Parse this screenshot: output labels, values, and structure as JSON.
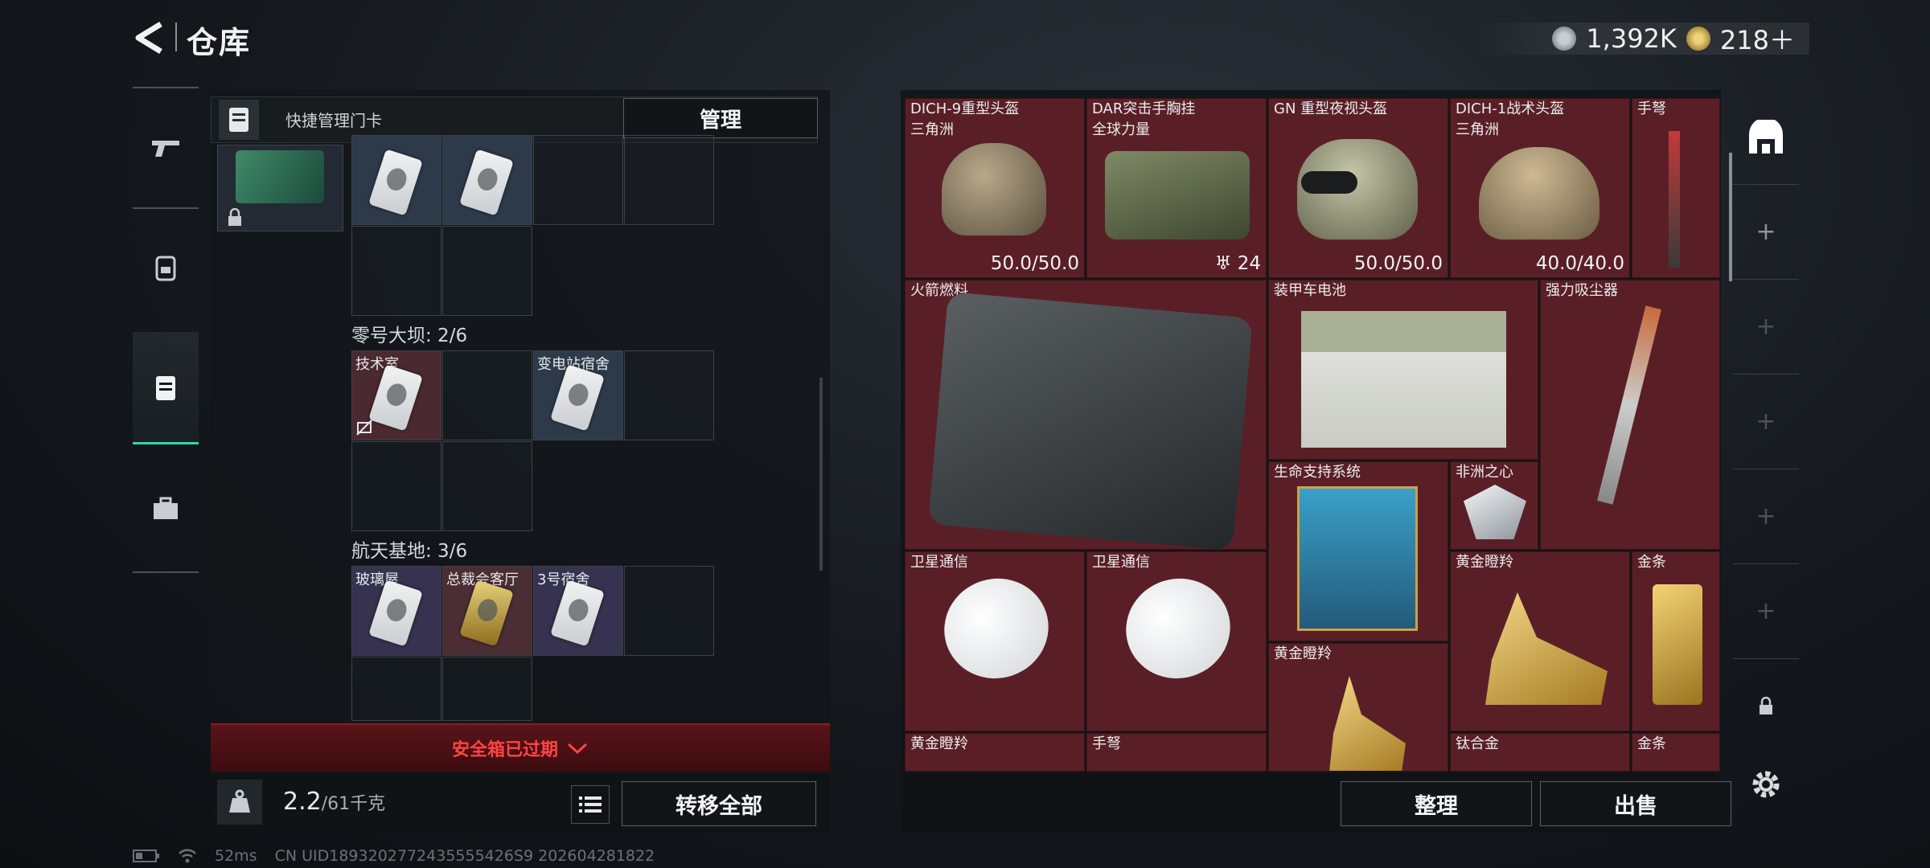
{
  "header": {
    "title": "仓库",
    "version": ""
  },
  "currency": {
    "coins": "1,392K",
    "tokens": "218＋"
  },
  "quick_manage": {
    "label": "快捷管理门卡",
    "manage_label": "管理"
  },
  "secure_case": {
    "row1": [
      {
        "label": ""
      },
      {
        "label": ""
      }
    ],
    "section2": {
      "label": "零号大坝: 2/6",
      "cards": [
        {
          "label": "技术室"
        },
        {
          "label": "变电站宿舍"
        }
      ]
    },
    "section3": {
      "label": "航天基地: 3/6",
      "cards": [
        {
          "label": "玻璃屋"
        },
        {
          "label": "总裁会客厅"
        },
        {
          "label": "3号宿舍"
        }
      ]
    },
    "expired_text": "安全箱已过期",
    "weight": {
      "value": "2.2",
      "capacity": "/61千克"
    },
    "transfer_all_label": "转移全部"
  },
  "inventory": {
    "items": [
      {
        "name": "DICH-9重型头盔",
        "sub": "三角洲",
        "durability": "50.0/50.0"
      },
      {
        "name": "DAR突击手胸挂",
        "sub": "全球力量",
        "count": "24"
      },
      {
        "name": "GN 重型夜视头盔",
        "durability": "50.0/50.0"
      },
      {
        "name": "DICH-1战术头盔",
        "sub": "三角洲",
        "durability": "40.0/40.0"
      },
      {
        "name": "手弩"
      },
      {
        "name": "火箭燃料"
      },
      {
        "name": "装甲车电池"
      },
      {
        "name": "强力吸尘器"
      },
      {
        "name": "生命支持系统"
      },
      {
        "name": "非洲之心"
      },
      {
        "name": "卫星通信"
      },
      {
        "name": "卫星通信"
      },
      {
        "name": "黄金瞪羚"
      },
      {
        "name": "金条"
      },
      {
        "name": "黄金瞪羚"
      },
      {
        "name": "黄金瞪羚"
      },
      {
        "name": "手弩"
      },
      {
        "name": "钛合金"
      },
      {
        "name": "金条"
      }
    ],
    "sort_label": "整理",
    "sell_label": "出售"
  },
  "status": {
    "ping": "52ms",
    "uid": "CN UID1893202772435555426S9 202604281822"
  },
  "colors": {
    "accent": "#2fd9a2",
    "alert": "#ff4444",
    "gold_rarity": "#5a1f26"
  }
}
